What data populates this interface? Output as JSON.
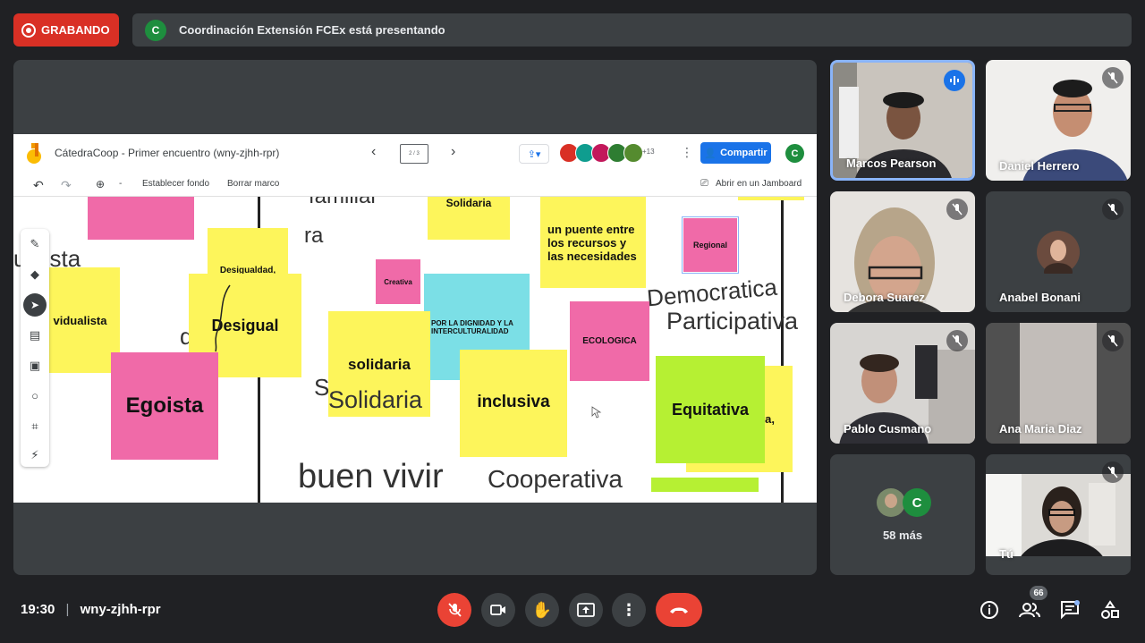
{
  "recording": {
    "label": "GRABANDO"
  },
  "presenting": {
    "avatar_letter": "C",
    "text": "Coordinación Extensión FCEx está presentando"
  },
  "jamboard": {
    "title": "CátedraCoop - Primer encuentro (wny-zjhh-rpr)",
    "frame_indicator": "2 / 3",
    "collab_count": "+13",
    "share_label": "Compartir",
    "user_letter": "C",
    "zoom_label": "-",
    "set_bg_label": "Establecer fondo",
    "clear_frame_label": "Borrar marco",
    "open_label": "Abrir en un Jamboard"
  },
  "canvas": {
    "words": [
      "familiar",
      "ra",
      "vidualista",
      "de",
      "S",
      "Solidaria",
      "buen vivir",
      "Cooperativa",
      "Democratica",
      "Participativa"
    ],
    "notes": {
      "solidaria_top": "Solidaria",
      "puente": "un puente entre los recursos y las necesidades",
      "regional": "Regional",
      "desigualdad": "Desigualdad,",
      "desigual": "Desigual",
      "individualista": "vidualista",
      "creativa": "Creativa",
      "dignidad": "POR LA DIGNIDAD Y LA INTERCULTURALIDAD",
      "ecologica": "ECOLOGICA",
      "solidaria": "solidaria",
      "egoista": "Egoista",
      "inclusiva": "inclusiva",
      "equitativa": "Equitativa",
      "partial": "a,"
    }
  },
  "participants": [
    {
      "name": "Marcos Pearson",
      "status": "speaking"
    },
    {
      "name": "Daniel Herrero",
      "status": "muted"
    },
    {
      "name": "Debora Suarez",
      "status": "muted"
    },
    {
      "name": "Anabel Bonani",
      "status": "muted"
    },
    {
      "name": "Pablo Cusmano",
      "status": "muted"
    },
    {
      "name": "Ana Maria Diaz",
      "status": "muted"
    },
    {
      "name": "Tú",
      "status": "muted"
    }
  ],
  "more": {
    "letter": "C",
    "label": "58 más"
  },
  "meeting": {
    "time": "19:30",
    "separator": "|",
    "code": "wny-zjhh-rpr"
  },
  "people_count": "66"
}
